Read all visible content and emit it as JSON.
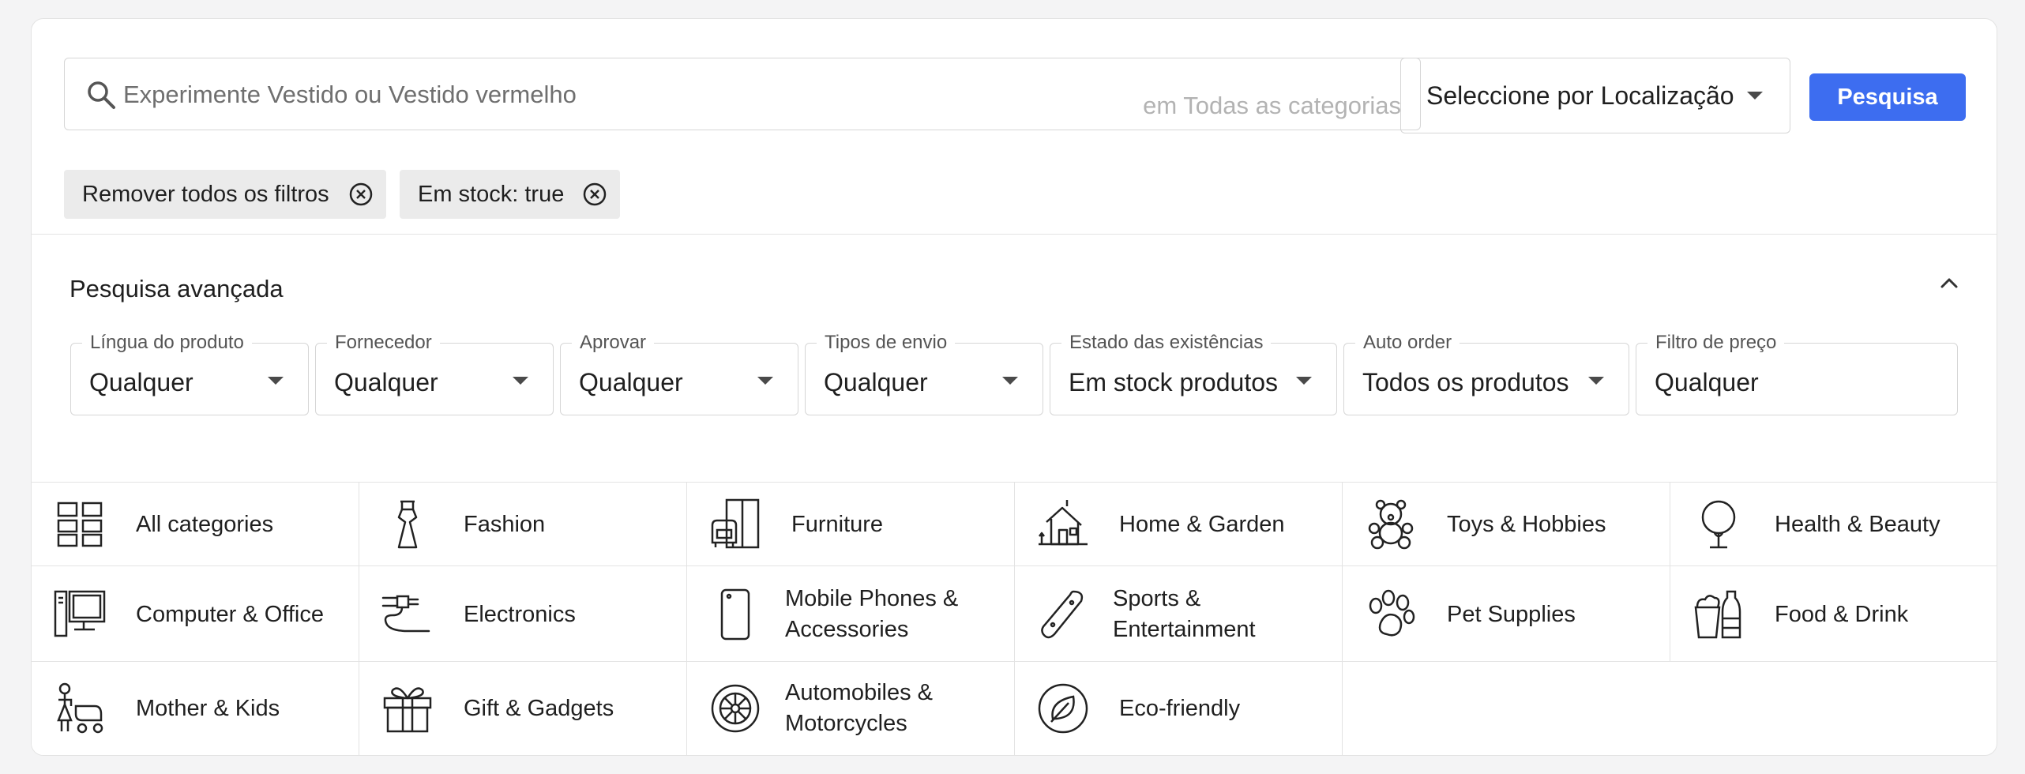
{
  "search": {
    "placeholder": "Experimente Vestido ou Vestido vermelho",
    "scope_hint": "em Todas as categorias",
    "location_label": "Seleccione por Localização",
    "button_label": "Pesquisa"
  },
  "chips": [
    {
      "label": "Remover todos os filtros",
      "icon": "close-circle-icon"
    },
    {
      "label": "Em stock: true",
      "icon": "close-circle-icon"
    }
  ],
  "advanced": {
    "title": "Pesquisa avançada",
    "toggle_icon": "chevron-up-icon",
    "filters": [
      {
        "label": "Língua do produto",
        "value": "Qualquer",
        "dropdown": true
      },
      {
        "label": "Fornecedor",
        "value": "Qualquer",
        "dropdown": true
      },
      {
        "label": "Aprovar",
        "value": "Qualquer",
        "dropdown": true
      },
      {
        "label": "Tipos de envio",
        "value": "Qualquer",
        "dropdown": true
      },
      {
        "label": "Estado das existências",
        "value": "Em stock produtos",
        "dropdown": true
      },
      {
        "label": "Auto order",
        "value": "Todos os produtos",
        "dropdown": true
      },
      {
        "label": "Filtro de preço",
        "value": "Qualquer",
        "dropdown": false
      }
    ]
  },
  "categories": [
    {
      "label": "All categories",
      "icon": "grid-icon"
    },
    {
      "label": "Fashion",
      "icon": "dress-icon"
    },
    {
      "label": "Furniture",
      "icon": "furniture-icon"
    },
    {
      "label": "Home & Garden",
      "icon": "house-icon"
    },
    {
      "label": "Toys & Hobbies",
      "icon": "teddy-bear-icon"
    },
    {
      "label": "Health & Beauty",
      "icon": "mirror-icon"
    },
    {
      "label": "Computer & Office",
      "icon": "computer-icon"
    },
    {
      "label": "Electronics",
      "icon": "cable-icon"
    },
    {
      "label": "Mobile Phones & Accessories",
      "icon": "phone-icon"
    },
    {
      "label": "Sports & Entertainment",
      "icon": "skateboard-icon"
    },
    {
      "label": "Pet Supplies",
      "icon": "paw-icon"
    },
    {
      "label": "Food & Drink",
      "icon": "food-drink-icon"
    },
    {
      "label": "Mother & Kids",
      "icon": "mother-stroller-icon"
    },
    {
      "label": "Gift & Gadgets",
      "icon": "gift-icon"
    },
    {
      "label": "Automobiles & Motorcycles",
      "icon": "wheel-icon"
    },
    {
      "label": "Eco-friendly",
      "icon": "leaf-icon"
    }
  ],
  "colors": {
    "accent": "#3d6df0",
    "chip_bg": "#ebebeb",
    "border": "#d6d6d6"
  }
}
